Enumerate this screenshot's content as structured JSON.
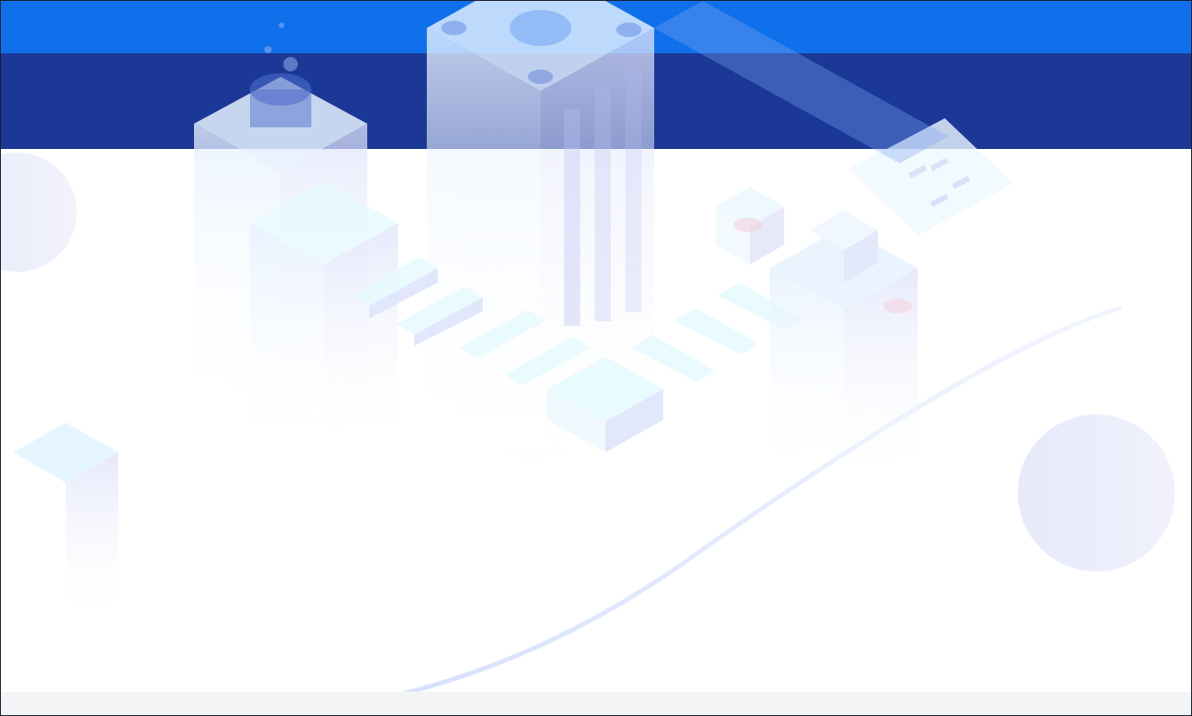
{
  "page": {
    "title": ""
  },
  "theme": {
    "top_bar_color": "#1070ec",
    "header_band_color": "#1b3897",
    "content_background": "#ffffff",
    "footer_color": "#f4f5f7",
    "illustration_tint": "#e8f4ff"
  },
  "illustration": {
    "subject": "isometric-city-blocks"
  }
}
